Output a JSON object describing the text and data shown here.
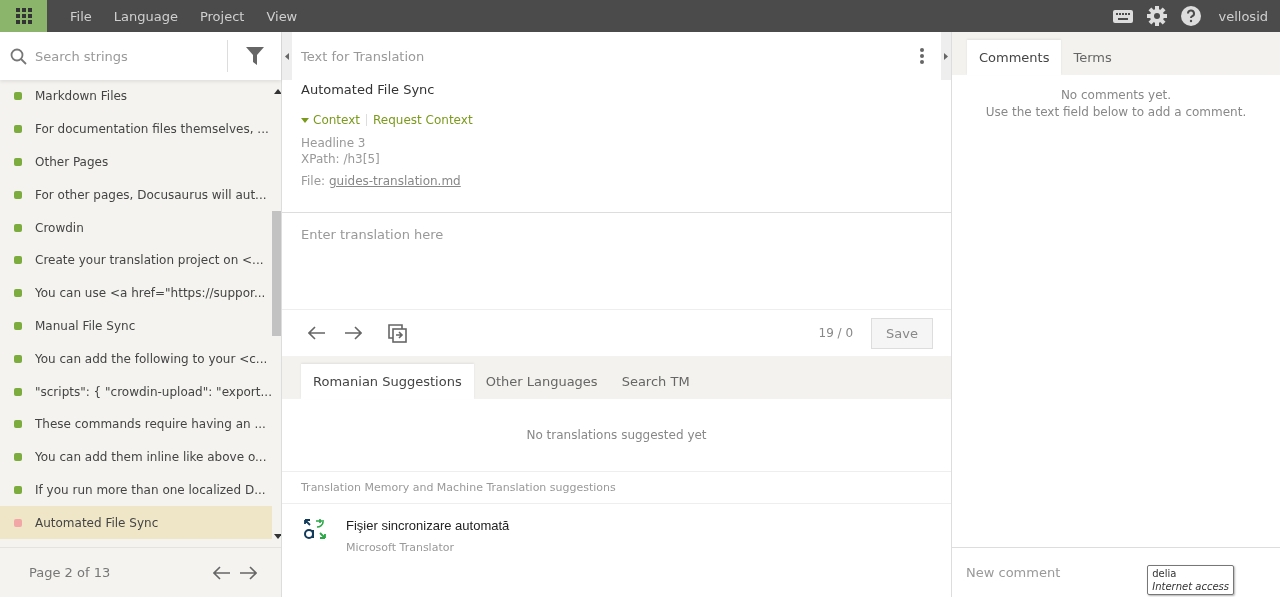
{
  "menu": {
    "items": [
      "File",
      "Language",
      "Project",
      "View"
    ],
    "user": "vellosid"
  },
  "strings": {
    "search": {
      "placeholder": "Search strings"
    },
    "items": [
      {
        "text": "Markdown Files",
        "color": "#7cab3e",
        "selected": false
      },
      {
        "text": "For documentation files themselves, ...",
        "color": "#7cab3e",
        "selected": false
      },
      {
        "text": "Other Pages",
        "color": "#7cab3e",
        "selected": false
      },
      {
        "text": "For other pages, Docusaurus will aut...",
        "color": "#7cab3e",
        "selected": false
      },
      {
        "text": "Crowdin",
        "color": "#7cab3e",
        "selected": false
      },
      {
        "text": "Create your translation project on <...",
        "color": "#7cab3e",
        "selected": false
      },
      {
        "text": "You can use <a href=\"https://suppor...",
        "color": "#7cab3e",
        "selected": false
      },
      {
        "text": "Manual File Sync",
        "color": "#7cab3e",
        "selected": false
      },
      {
        "text": "You can add the following to your <c...",
        "color": "#7cab3e",
        "selected": false
      },
      {
        "text": "\"scripts\": { \"crowdin-upload\": \"export...",
        "color": "#7cab3e",
        "selected": false
      },
      {
        "text": "These commands require having an ...",
        "color": "#7cab3e",
        "selected": false
      },
      {
        "text": "You can add them inline like above o...",
        "color": "#7cab3e",
        "selected": false
      },
      {
        "text": "If you run more than one localized D...",
        "color": "#7cab3e",
        "selected": false
      },
      {
        "text": "Automated File Sync",
        "color": "#f2a6a6",
        "selected": true
      }
    ],
    "pager": "Page 2 of 13"
  },
  "source": {
    "title": "Text for Translation",
    "text": "Automated File Sync",
    "context_link": "Context",
    "request_link": "Request Context",
    "context_lines": [
      "Headline 3",
      "XPath: /h3[5]"
    ],
    "file_label": "File:",
    "file_name": "guides-translation.md"
  },
  "translation": {
    "placeholder": "Enter translation here",
    "counter": "19 / 0",
    "save": "Save"
  },
  "suggestions": {
    "tabs": [
      {
        "label": "Romanian Suggestions",
        "selected": true
      },
      {
        "label": "Other Languages",
        "selected": false
      },
      {
        "label": "Search TM",
        "selected": false
      }
    ],
    "empty": "No translations suggested yet",
    "tm_heading": "Translation Memory and Machine Translation suggestions",
    "items": [
      {
        "text": "Fişier sincronizare automată",
        "source": "Microsoft Translator"
      }
    ]
  },
  "comments": {
    "tabs": [
      {
        "label": "Comments",
        "selected": true
      },
      {
        "label": "Terms",
        "selected": false
      }
    ],
    "empty": [
      "No comments yet.",
      "Use the text field below to add a comment."
    ],
    "placeholder": "New comment"
  },
  "tooltip": {
    "title": "delia",
    "subtitle": "Internet access"
  }
}
